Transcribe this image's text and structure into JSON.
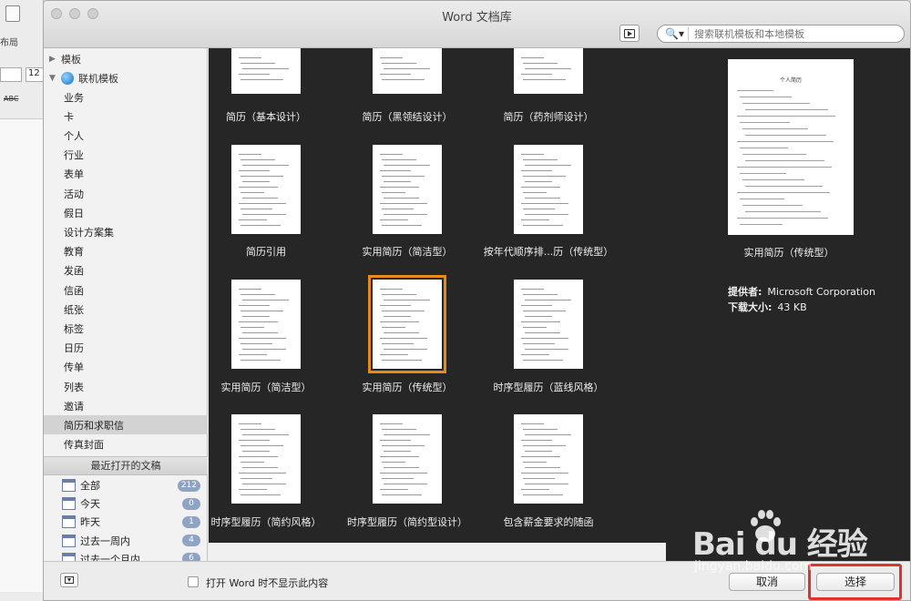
{
  "background": {
    "bg_text": "布局",
    "bg_font_size": "12",
    "bg_abc": "ABC"
  },
  "window": {
    "title": "Word 文档库"
  },
  "search": {
    "placeholder": "搜索联机模板和本地模板"
  },
  "sidebar": {
    "templates_label": "模板",
    "online_label": "联机模板",
    "items": [
      "业务",
      "卡",
      "个人",
      "行业",
      "表单",
      "活动",
      "假日",
      "设计方案集",
      "教育",
      "发函",
      "信函",
      "纸张",
      "标签",
      "日历",
      "传单",
      "列表",
      "邀请",
      "简历和求职信",
      "传真封面"
    ],
    "selected_index": 17,
    "recent_header": "最近打开的文稿",
    "recent": [
      {
        "label": "全部",
        "count": "212"
      },
      {
        "label": "今天",
        "count": "0"
      },
      {
        "label": "昨天",
        "count": "1"
      },
      {
        "label": "过去一周内",
        "count": "4"
      },
      {
        "label": "过去一个月内",
        "count": "6"
      }
    ]
  },
  "templates": [
    {
      "caption": "简历（基本设计）"
    },
    {
      "caption": "简历（黑领结设计）"
    },
    {
      "caption": "简历（药剂师设计）"
    },
    {
      "caption": "简历引用"
    },
    {
      "caption": "实用简历（简洁型）"
    },
    {
      "caption": "按年代顺序排...历（传统型）"
    },
    {
      "caption": "实用简历（简洁型）"
    },
    {
      "caption": "实用简历（传统型）"
    },
    {
      "caption": "时序型履历（蓝线风格）"
    },
    {
      "caption": "时序型履历（简约风格）"
    },
    {
      "caption": "时序型履历（简约型设计）"
    },
    {
      "caption": "包含薪金要求的随函"
    }
  ],
  "selected_template_index": 7,
  "preview": {
    "page_heading": "个人简历",
    "title": "实用简历（传统型）",
    "provider_label": "提供者:",
    "provider_value": "Microsoft Corporation",
    "size_label": "下载大小:",
    "size_value": "43 KB"
  },
  "footer": {
    "dont_show_label": "打开 Word 时不显示此内容",
    "cancel_label": "取消",
    "choose_label": "选择"
  },
  "watermark": {
    "brand": "Bai du 经验",
    "url": "jingyan.baidu.com"
  },
  "colors": {
    "grid_bg": "#262626",
    "selection": "#e58a14",
    "highlight": "#e0332e",
    "badge": "#8fa3c4"
  }
}
